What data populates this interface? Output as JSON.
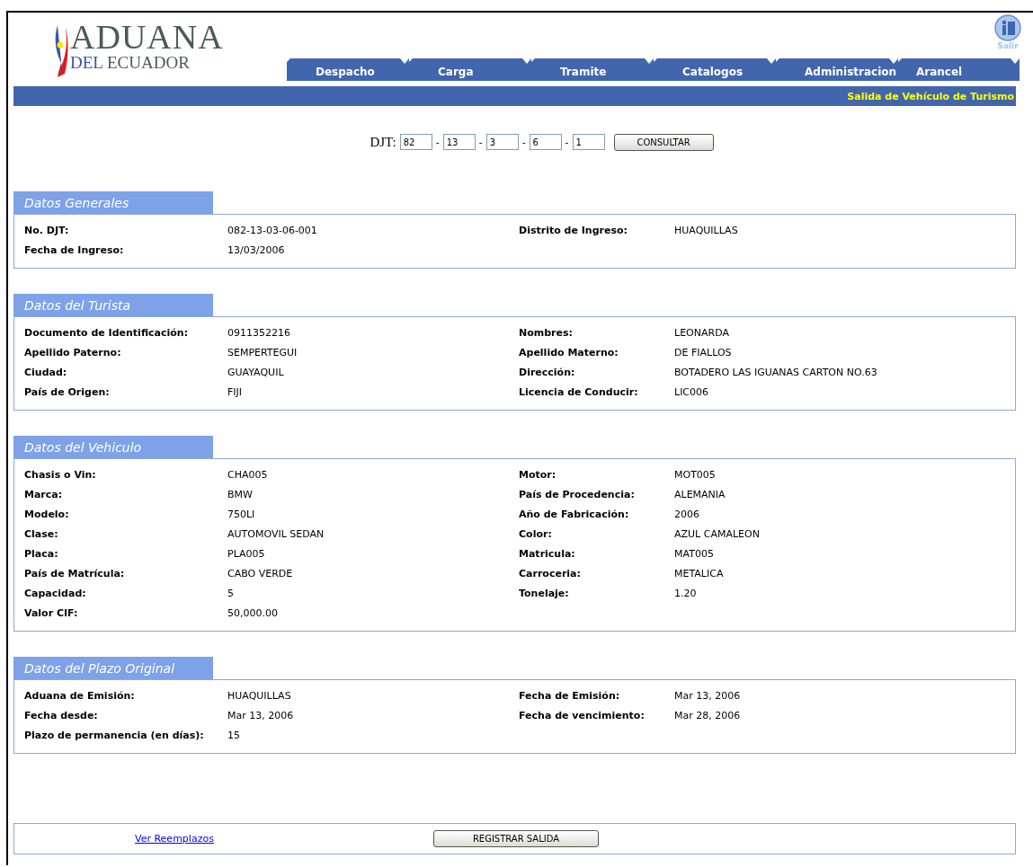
{
  "logo": {
    "line_1": "ADUANA",
    "line_2_a": "DEL",
    "line_2_b": "ECUADOR"
  },
  "logout": {
    "label": "Salir"
  },
  "tabs": [
    {
      "label": "Despacho"
    },
    {
      "label": "Carga"
    },
    {
      "label": "Tramite"
    },
    {
      "label": "Catalogos"
    },
    {
      "label": "Administracion"
    },
    {
      "label": "Arancel"
    }
  ],
  "page_title": "Salida de Vehículo de Turismo",
  "query": {
    "label": "DJT:",
    "separator": "-",
    "fields": [
      "82",
      "13",
      "3",
      "6",
      "1"
    ],
    "button": "CONSULTAR"
  },
  "sections": [
    {
      "title": "Datos Generales",
      "fields": [
        {
          "label": "No. DJT:",
          "value": "082-13-03-06-001"
        },
        {
          "label": "Distrito de Ingreso:",
          "value": "HUAQUILLAS"
        },
        {
          "label": "Fecha de Ingreso:",
          "value": "13/03/2006"
        }
      ]
    },
    {
      "title": "Datos del Turista",
      "fields": [
        {
          "label": "Documento de Identificación:",
          "value": "0911352216"
        },
        {
          "label": "Nombres:",
          "value": "LEONARDA"
        },
        {
          "label": "Apellido Paterno:",
          "value": "SEMPERTEGUI"
        },
        {
          "label": "Apellido Materno:",
          "value": "DE FIALLOS"
        },
        {
          "label": "Ciudad:",
          "value": "GUAYAQUIL"
        },
        {
          "label": "Dirección:",
          "value": "BOTADERO LAS IGUANAS CARTON NO.63"
        },
        {
          "label": "País de Origen:",
          "value": "FIJI"
        },
        {
          "label": "Licencia de Conducir:",
          "value": "LIC006"
        }
      ]
    },
    {
      "title": "Datos del Vehiculo",
      "fields": [
        {
          "label": "Chasis o Vin:",
          "value": "CHA005"
        },
        {
          "label": "Motor:",
          "value": "MOT005"
        },
        {
          "label": "Marca:",
          "value": "BMW"
        },
        {
          "label": "País de Procedencia:",
          "value": "ALEMANIA"
        },
        {
          "label": "Modelo:",
          "value": "750LI"
        },
        {
          "label": "Año de Fabricación:",
          "value": "2006"
        },
        {
          "label": "Clase:",
          "value": "AUTOMOVIL SEDAN"
        },
        {
          "label": "Color:",
          "value": "AZUL CAMALEON"
        },
        {
          "label": "Placa:",
          "value": "PLA005"
        },
        {
          "label": "Matricula:",
          "value": "MAT005"
        },
        {
          "label": "País de Matrícula:",
          "value": "CABO VERDE"
        },
        {
          "label": "Carroceria:",
          "value": "METALICA"
        },
        {
          "label": "Capacidad:",
          "value": "5"
        },
        {
          "label": "Tonelaje:",
          "value": "1.20"
        },
        {
          "label": "Valor CIF:",
          "value": "50,000.00"
        }
      ]
    },
    {
      "title": "Datos del Plazo Original",
      "fields": [
        {
          "label": "Aduana de Emisión:",
          "value": "HUAQUILLAS"
        },
        {
          "label": "Fecha de Emisión:",
          "value": "Mar 13, 2006"
        },
        {
          "label": "Fecha desde:",
          "value": "Mar 13, 2006"
        },
        {
          "label": "Fecha de vencimiento:",
          "value": "Mar 28, 2006"
        },
        {
          "label": "Plazo de permanencia (en días):",
          "value": "15"
        }
      ]
    }
  ],
  "footer": {
    "link": "Ver Reemplazos",
    "button": "REGISTRAR SALIDA"
  }
}
